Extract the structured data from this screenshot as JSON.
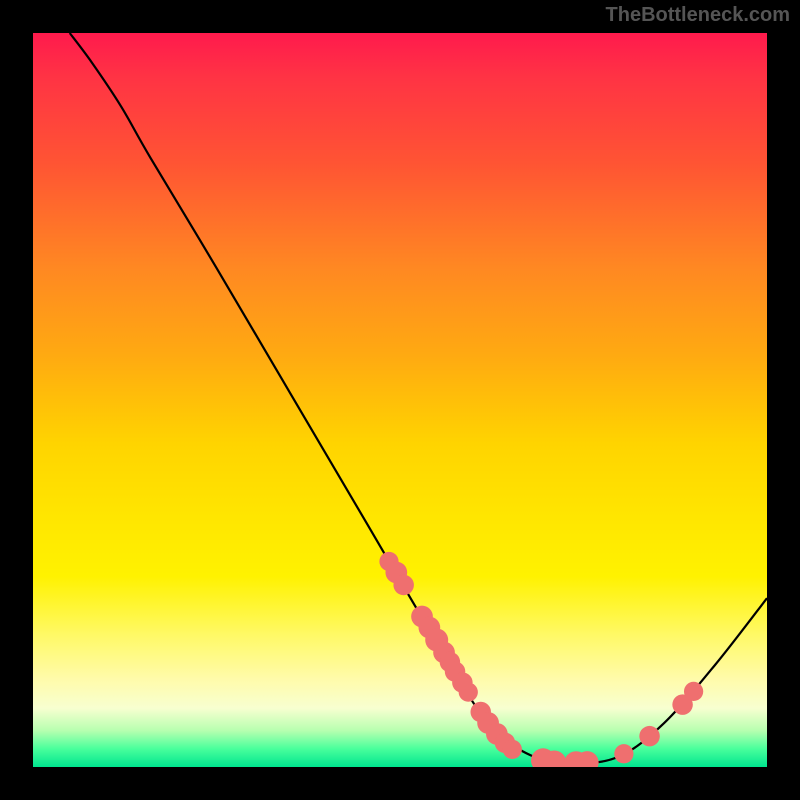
{
  "attribution": "TheBottleneck.com",
  "chart_data": {
    "type": "line",
    "title": "",
    "xlabel": "",
    "ylabel": "",
    "xlim": [
      0,
      100
    ],
    "ylim": [
      0,
      100
    ],
    "gradient_colors_top_to_bottom": [
      "#ff1a4d",
      "#ffd400",
      "#fff966",
      "#00e58f"
    ],
    "curve": [
      {
        "x": 5,
        "y": 100
      },
      {
        "x": 8,
        "y": 96
      },
      {
        "x": 12,
        "y": 90
      },
      {
        "x": 16,
        "y": 83
      },
      {
        "x": 25,
        "y": 68
      },
      {
        "x": 35,
        "y": 51
      },
      {
        "x": 45,
        "y": 34
      },
      {
        "x": 55,
        "y": 17
      },
      {
        "x": 62,
        "y": 6
      },
      {
        "x": 68,
        "y": 1.5
      },
      {
        "x": 74,
        "y": 0.5
      },
      {
        "x": 80,
        "y": 1.5
      },
      {
        "x": 86,
        "y": 6
      },
      {
        "x": 93,
        "y": 14
      },
      {
        "x": 100,
        "y": 23
      }
    ],
    "markers": [
      {
        "x": 48.5,
        "y": 28.0,
        "r": 0.9
      },
      {
        "x": 49.5,
        "y": 26.5,
        "r": 1.1
      },
      {
        "x": 50.5,
        "y": 24.8,
        "r": 1.0
      },
      {
        "x": 53.0,
        "y": 20.5,
        "r": 1.1
      },
      {
        "x": 54.0,
        "y": 19.0,
        "r": 1.1
      },
      {
        "x": 55.0,
        "y": 17.3,
        "r": 1.2
      },
      {
        "x": 56.0,
        "y": 15.6,
        "r": 1.1
      },
      {
        "x": 56.8,
        "y": 14.3,
        "r": 1.0
      },
      {
        "x": 57.5,
        "y": 13.0,
        "r": 1.0
      },
      {
        "x": 58.5,
        "y": 11.5,
        "r": 1.0
      },
      {
        "x": 59.3,
        "y": 10.2,
        "r": 0.9
      },
      {
        "x": 61.0,
        "y": 7.5,
        "r": 1.0
      },
      {
        "x": 62.0,
        "y": 6.0,
        "r": 1.1
      },
      {
        "x": 63.2,
        "y": 4.5,
        "r": 1.1
      },
      {
        "x": 64.3,
        "y": 3.3,
        "r": 1.0
      },
      {
        "x": 65.3,
        "y": 2.4,
        "r": 0.9
      },
      {
        "x": 69.5,
        "y": 0.9,
        "r": 1.3
      },
      {
        "x": 71.0,
        "y": 0.6,
        "r": 1.3
      },
      {
        "x": 74.0,
        "y": 0.5,
        "r": 1.3
      },
      {
        "x": 75.5,
        "y": 0.6,
        "r": 1.2
      },
      {
        "x": 80.5,
        "y": 1.8,
        "r": 0.9
      },
      {
        "x": 84.0,
        "y": 4.2,
        "r": 1.0
      },
      {
        "x": 88.5,
        "y": 8.5,
        "r": 1.0
      },
      {
        "x": 90.0,
        "y": 10.3,
        "r": 0.9
      }
    ]
  }
}
